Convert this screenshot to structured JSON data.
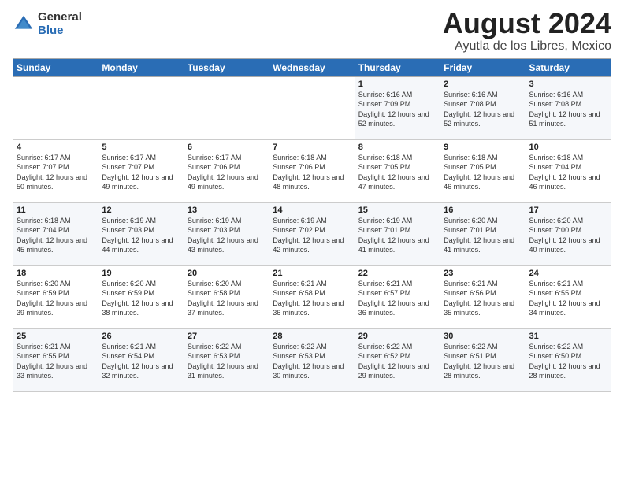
{
  "logo": {
    "general": "General",
    "blue": "Blue"
  },
  "title": "August 2024",
  "location": "Ayutla de los Libres, Mexico",
  "headers": [
    "Sunday",
    "Monday",
    "Tuesday",
    "Wednesday",
    "Thursday",
    "Friday",
    "Saturday"
  ],
  "weeks": [
    [
      {
        "day": "",
        "sunrise": "",
        "sunset": "",
        "daylight": "",
        "empty": true
      },
      {
        "day": "",
        "sunrise": "",
        "sunset": "",
        "daylight": "",
        "empty": true
      },
      {
        "day": "",
        "sunrise": "",
        "sunset": "",
        "daylight": "",
        "empty": true
      },
      {
        "day": "",
        "sunrise": "",
        "sunset": "",
        "daylight": "",
        "empty": true
      },
      {
        "day": "1",
        "sunrise": "Sunrise: 6:16 AM",
        "sunset": "Sunset: 7:09 PM",
        "daylight": "Daylight: 12 hours and 52 minutes."
      },
      {
        "day": "2",
        "sunrise": "Sunrise: 6:16 AM",
        "sunset": "Sunset: 7:08 PM",
        "daylight": "Daylight: 12 hours and 52 minutes."
      },
      {
        "day": "3",
        "sunrise": "Sunrise: 6:16 AM",
        "sunset": "Sunset: 7:08 PM",
        "daylight": "Daylight: 12 hours and 51 minutes."
      }
    ],
    [
      {
        "day": "4",
        "sunrise": "Sunrise: 6:17 AM",
        "sunset": "Sunset: 7:07 PM",
        "daylight": "Daylight: 12 hours and 50 minutes."
      },
      {
        "day": "5",
        "sunrise": "Sunrise: 6:17 AM",
        "sunset": "Sunset: 7:07 PM",
        "daylight": "Daylight: 12 hours and 49 minutes."
      },
      {
        "day": "6",
        "sunrise": "Sunrise: 6:17 AM",
        "sunset": "Sunset: 7:06 PM",
        "daylight": "Daylight: 12 hours and 49 minutes."
      },
      {
        "day": "7",
        "sunrise": "Sunrise: 6:18 AM",
        "sunset": "Sunset: 7:06 PM",
        "daylight": "Daylight: 12 hours and 48 minutes."
      },
      {
        "day": "8",
        "sunrise": "Sunrise: 6:18 AM",
        "sunset": "Sunset: 7:05 PM",
        "daylight": "Daylight: 12 hours and 47 minutes."
      },
      {
        "day": "9",
        "sunrise": "Sunrise: 6:18 AM",
        "sunset": "Sunset: 7:05 PM",
        "daylight": "Daylight: 12 hours and 46 minutes."
      },
      {
        "day": "10",
        "sunrise": "Sunrise: 6:18 AM",
        "sunset": "Sunset: 7:04 PM",
        "daylight": "Daylight: 12 hours and 46 minutes."
      }
    ],
    [
      {
        "day": "11",
        "sunrise": "Sunrise: 6:18 AM",
        "sunset": "Sunset: 7:04 PM",
        "daylight": "Daylight: 12 hours and 45 minutes."
      },
      {
        "day": "12",
        "sunrise": "Sunrise: 6:19 AM",
        "sunset": "Sunset: 7:03 PM",
        "daylight": "Daylight: 12 hours and 44 minutes."
      },
      {
        "day": "13",
        "sunrise": "Sunrise: 6:19 AM",
        "sunset": "Sunset: 7:03 PM",
        "daylight": "Daylight: 12 hours and 43 minutes."
      },
      {
        "day": "14",
        "sunrise": "Sunrise: 6:19 AM",
        "sunset": "Sunset: 7:02 PM",
        "daylight": "Daylight: 12 hours and 42 minutes."
      },
      {
        "day": "15",
        "sunrise": "Sunrise: 6:19 AM",
        "sunset": "Sunset: 7:01 PM",
        "daylight": "Daylight: 12 hours and 41 minutes."
      },
      {
        "day": "16",
        "sunrise": "Sunrise: 6:20 AM",
        "sunset": "Sunset: 7:01 PM",
        "daylight": "Daylight: 12 hours and 41 minutes."
      },
      {
        "day": "17",
        "sunrise": "Sunrise: 6:20 AM",
        "sunset": "Sunset: 7:00 PM",
        "daylight": "Daylight: 12 hours and 40 minutes."
      }
    ],
    [
      {
        "day": "18",
        "sunrise": "Sunrise: 6:20 AM",
        "sunset": "Sunset: 6:59 PM",
        "daylight": "Daylight: 12 hours and 39 minutes."
      },
      {
        "day": "19",
        "sunrise": "Sunrise: 6:20 AM",
        "sunset": "Sunset: 6:59 PM",
        "daylight": "Daylight: 12 hours and 38 minutes."
      },
      {
        "day": "20",
        "sunrise": "Sunrise: 6:20 AM",
        "sunset": "Sunset: 6:58 PM",
        "daylight": "Daylight: 12 hours and 37 minutes."
      },
      {
        "day": "21",
        "sunrise": "Sunrise: 6:21 AM",
        "sunset": "Sunset: 6:58 PM",
        "daylight": "Daylight: 12 hours and 36 minutes."
      },
      {
        "day": "22",
        "sunrise": "Sunrise: 6:21 AM",
        "sunset": "Sunset: 6:57 PM",
        "daylight": "Daylight: 12 hours and 36 minutes."
      },
      {
        "day": "23",
        "sunrise": "Sunrise: 6:21 AM",
        "sunset": "Sunset: 6:56 PM",
        "daylight": "Daylight: 12 hours and 35 minutes."
      },
      {
        "day": "24",
        "sunrise": "Sunrise: 6:21 AM",
        "sunset": "Sunset: 6:55 PM",
        "daylight": "Daylight: 12 hours and 34 minutes."
      }
    ],
    [
      {
        "day": "25",
        "sunrise": "Sunrise: 6:21 AM",
        "sunset": "Sunset: 6:55 PM",
        "daylight": "Daylight: 12 hours and 33 minutes."
      },
      {
        "day": "26",
        "sunrise": "Sunrise: 6:21 AM",
        "sunset": "Sunset: 6:54 PM",
        "daylight": "Daylight: 12 hours and 32 minutes."
      },
      {
        "day": "27",
        "sunrise": "Sunrise: 6:22 AM",
        "sunset": "Sunset: 6:53 PM",
        "daylight": "Daylight: 12 hours and 31 minutes."
      },
      {
        "day": "28",
        "sunrise": "Sunrise: 6:22 AM",
        "sunset": "Sunset: 6:53 PM",
        "daylight": "Daylight: 12 hours and 30 minutes."
      },
      {
        "day": "29",
        "sunrise": "Sunrise: 6:22 AM",
        "sunset": "Sunset: 6:52 PM",
        "daylight": "Daylight: 12 hours and 29 minutes."
      },
      {
        "day": "30",
        "sunrise": "Sunrise: 6:22 AM",
        "sunset": "Sunset: 6:51 PM",
        "daylight": "Daylight: 12 hours and 28 minutes."
      },
      {
        "day": "31",
        "sunrise": "Sunrise: 6:22 AM",
        "sunset": "Sunset: 6:50 PM",
        "daylight": "Daylight: 12 hours and 28 minutes."
      }
    ]
  ]
}
